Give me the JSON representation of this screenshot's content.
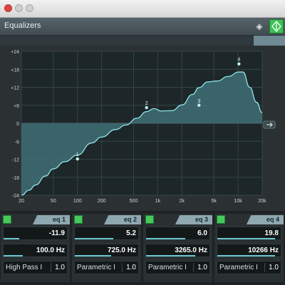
{
  "window": {
    "title": ""
  },
  "header": {
    "title": "Equalizers"
  },
  "colors": {
    "curve_fill": "#3f6f76",
    "curve_line": "#8fe6e6",
    "grid": "#344548",
    "accent_green": "#46c85b"
  },
  "graph": {
    "y_ticks": [
      "+24",
      "+18",
      "+12",
      "+6",
      "0",
      "-6",
      "-12",
      "-18",
      "-24"
    ],
    "x_ticks": [
      "20",
      "50",
      "100",
      "200",
      "500",
      "1k",
      "2k",
      "5k",
      "10k",
      "20k"
    ]
  },
  "chart_data": {
    "type": "area",
    "xlabel": "",
    "ylabel": "",
    "xscale": "log",
    "xlim": [
      20,
      20000
    ],
    "ylim": [
      -24,
      24
    ],
    "series": [
      {
        "x": [
          20,
          25,
          30,
          40,
          50,
          70,
          100,
          150,
          200,
          300,
          400,
          550,
          725,
          900,
          1100,
          1500,
          2000,
          2700,
          3265,
          4200,
          5500,
          7500,
          10266,
          11500,
          14000,
          17000,
          20000
        ],
        "y": [
          -24,
          -22.3,
          -20.6,
          -17.6,
          -15.2,
          -12.8,
          -10.6,
          -6.6,
          -4.6,
          -2.1,
          -0.6,
          1.7,
          3.9,
          4.9,
          4.1,
          4.2,
          6.1,
          9.6,
          11.9,
          13.8,
          14.1,
          15.6,
          17.1,
          17.1,
          12.0,
          7.0,
          3.5
        ]
      }
    ],
    "points": [
      {
        "label": "1",
        "x": 100,
        "y": -11.9
      },
      {
        "label": "2",
        "x": 725,
        "y": 5.2
      },
      {
        "label": "3",
        "x": 3265,
        "y": 6.0
      },
      {
        "label": "4",
        "x": 10266,
        "y": 19.8
      }
    ],
    "grid": true
  },
  "bands": [
    {
      "name": "eq 1",
      "gain": "-11.9",
      "freq": "100.0 Hz",
      "type": "High Pass I",
      "q": "1.0",
      "gain_level": 0.25,
      "freq_level": 0.3
    },
    {
      "name": "eq 2",
      "gain": "5.2",
      "freq": "725.0 Hz",
      "type": "Parametric I",
      "q": "1.0",
      "gain_level": 0.61,
      "freq_level": 0.57
    },
    {
      "name": "eq 3",
      "gain": "6.0",
      "freq": "3265.0 Hz",
      "type": "Parametric I",
      "q": "1.0",
      "gain_level": 0.62,
      "freq_level": 0.77
    },
    {
      "name": "eq 4",
      "gain": "19.8",
      "freq": "10266 Hz",
      "type": "Parametric I",
      "q": "1.0",
      "gain_level": 0.91,
      "freq_level": 0.91
    }
  ],
  "icons": {
    "preset": "preset-diamond-icon",
    "bypass": "bypass-icon",
    "power": "power-icon",
    "reset": "reset-icon"
  }
}
